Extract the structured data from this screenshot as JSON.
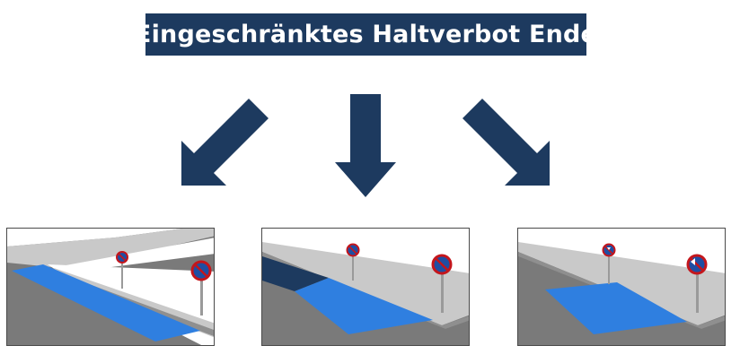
{
  "title": "Eingeschränktes Haltverbot Ende",
  "colors": {
    "title_bg": "#1d3a5f",
    "arrow": "#1d3a5f",
    "road": "#7a7a7a",
    "sidewalk": "#c9c9c9",
    "zone": "#2f7fe0",
    "sign_red": "#c4161c",
    "sign_blue": "#1f4ea3"
  },
  "icons": {
    "arrows": [
      "arrow-down-left-icon",
      "arrow-down-icon",
      "arrow-down-right-icon"
    ],
    "sign": "eingeschraenktes-haltverbot-sign-icon"
  }
}
